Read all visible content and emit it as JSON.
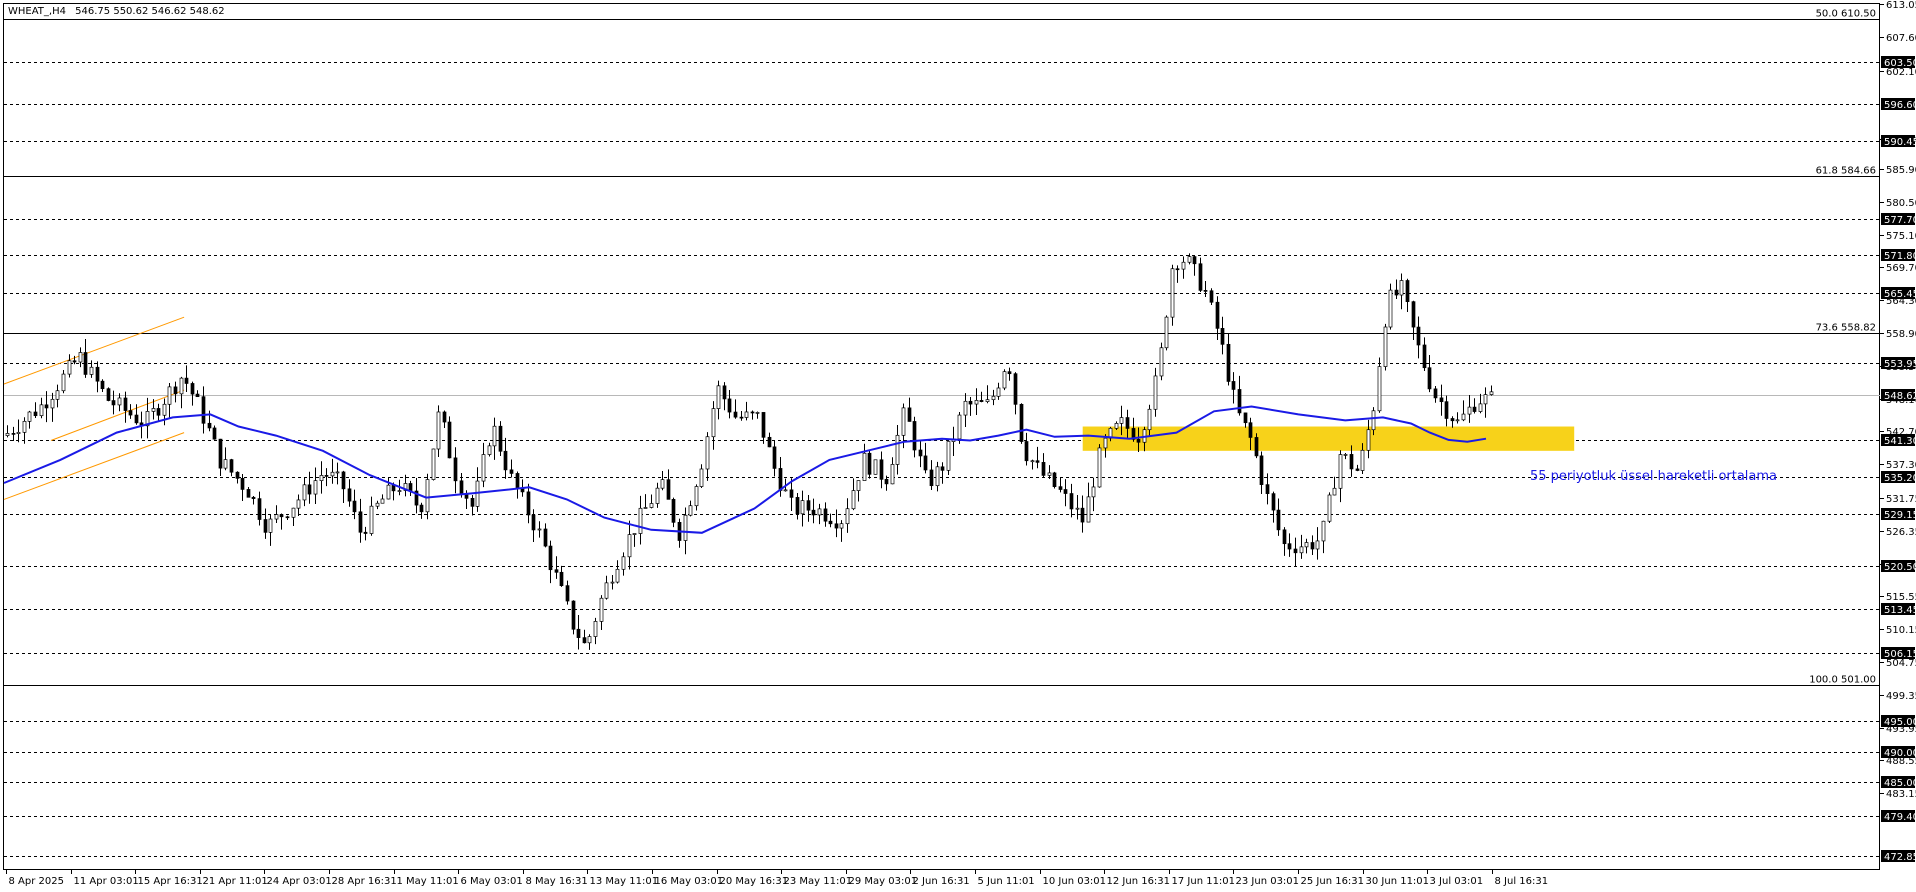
{
  "header": {
    "symbol": "WHEAT_,H4",
    "ohlc": "546.75 550.62 546.62 548.62"
  },
  "chart_data": {
    "type": "candlestick",
    "ylim": [
      470.5,
      613.05
    ],
    "y_ticks": [
      613.05,
      607.6,
      602.1,
      590.9,
      585.9,
      580.5,
      575.1,
      569.7,
      564.3,
      558.9,
      553.5,
      548.1,
      542.7,
      537.3,
      531.75,
      526.35,
      520.95,
      515.55,
      510.15,
      504.75,
      499.35,
      493.95,
      488.55,
      483.15
    ],
    "x_labels": [
      "8 Apr 2025",
      "11 Apr 03:01",
      "15 Apr 16:31",
      "21 Apr 11:01",
      "24 Apr 03:01",
      "28 Apr 16:31",
      "1 May 11:01",
      "6 May 03:01",
      "8 May 16:31",
      "13 May 11:01",
      "16 May 03:01",
      "20 May 16:31",
      "23 May 11:01",
      "29 May 03:01",
      "2 Jun 16:31",
      "5 Jun 11:01",
      "10 Jun 03:01",
      "12 Jun 16:31",
      "17 Jun 11:01",
      "23 Jun 03:01",
      "25 Jun 16:31",
      "30 Jun 11:01",
      "3 Jul 03:01",
      "8 Jul 16:31"
    ],
    "levels": [
      603.5,
      596.6,
      590.45,
      577.7,
      571.8,
      565.45,
      553.95,
      541.3,
      535.2,
      529.15,
      520.5,
      513.45,
      506.15,
      495.0,
      490.0,
      485.0,
      479.4,
      472.85
    ],
    "current_price": 548.62,
    "fib_levels": [
      {
        "label": "50.0 610.50",
        "value": 610.5
      },
      {
        "label": "61.8 584.66",
        "value": 584.66
      },
      {
        "label": "73.6 558.82",
        "value": 558.82
      },
      {
        "label": "100.0 501.00",
        "value": 501.0
      }
    ],
    "zone": {
      "low": 539.5,
      "high": 543.5,
      "x_from": 0.575,
      "x_to": 0.837
    },
    "ema_label": "55 periyotluk üssel hareketli ortalama",
    "price_path": [
      [
        0.0,
        542
      ],
      [
        0.02,
        547
      ],
      [
        0.04,
        555
      ],
      [
        0.055,
        548
      ],
      [
        0.075,
        544
      ],
      [
        0.095,
        552
      ],
      [
        0.105,
        546
      ],
      [
        0.115,
        538
      ],
      [
        0.13,
        533
      ],
      [
        0.14,
        527
      ],
      [
        0.155,
        531
      ],
      [
        0.17,
        536
      ],
      [
        0.18,
        534
      ],
      [
        0.19,
        526
      ],
      [
        0.2,
        531
      ],
      [
        0.21,
        534
      ],
      [
        0.222,
        530
      ],
      [
        0.232,
        546
      ],
      [
        0.24,
        536
      ],
      [
        0.25,
        530
      ],
      [
        0.26,
        544
      ],
      [
        0.27,
        535
      ],
      [
        0.285,
        526
      ],
      [
        0.295,
        518
      ],
      [
        0.303,
        511
      ],
      [
        0.31,
        507
      ],
      [
        0.318,
        515
      ],
      [
        0.326,
        521
      ],
      [
        0.336,
        527
      ],
      [
        0.35,
        534
      ],
      [
        0.36,
        526
      ],
      [
        0.372,
        538
      ],
      [
        0.38,
        550
      ],
      [
        0.39,
        545
      ],
      [
        0.402,
        545
      ],
      [
        0.41,
        537
      ],
      [
        0.42,
        530
      ],
      [
        0.432,
        530
      ],
      [
        0.446,
        528
      ],
      [
        0.458,
        538
      ],
      [
        0.47,
        535
      ],
      [
        0.48,
        546
      ],
      [
        0.492,
        534
      ],
      [
        0.5,
        537
      ],
      [
        0.512,
        547
      ],
      [
        0.525,
        547
      ],
      [
        0.535,
        555
      ],
      [
        0.543,
        540
      ],
      [
        0.552,
        536
      ],
      [
        0.562,
        533
      ],
      [
        0.575,
        528
      ],
      [
        0.585,
        540
      ],
      [
        0.595,
        544
      ],
      [
        0.605,
        542
      ],
      [
        0.615,
        552
      ],
      [
        0.623,
        571
      ],
      [
        0.63,
        571
      ],
      [
        0.64,
        566
      ],
      [
        0.648,
        558
      ],
      [
        0.657,
        546
      ],
      [
        0.665,
        541
      ],
      [
        0.673,
        532
      ],
      [
        0.682,
        524
      ],
      [
        0.694,
        524
      ],
      [
        0.702,
        525
      ],
      [
        0.712,
        539
      ],
      [
        0.722,
        536
      ],
      [
        0.73,
        547
      ],
      [
        0.737,
        564
      ],
      [
        0.745,
        566
      ],
      [
        0.752,
        558
      ],
      [
        0.762,
        549
      ],
      [
        0.775,
        544
      ],
      [
        0.785,
        548
      ],
      [
        0.795,
        548
      ]
    ],
    "ema_path": [
      [
        0.0,
        534.2
      ],
      [
        0.03,
        538
      ],
      [
        0.06,
        542.5
      ],
      [
        0.09,
        545
      ],
      [
        0.11,
        545.5
      ],
      [
        0.125,
        543.5
      ],
      [
        0.145,
        542
      ],
      [
        0.17,
        539.5
      ],
      [
        0.195,
        535.5
      ],
      [
        0.225,
        531.8
      ],
      [
        0.25,
        532.5
      ],
      [
        0.28,
        533.5
      ],
      [
        0.3,
        531.5
      ],
      [
        0.32,
        528.5
      ],
      [
        0.345,
        526.5
      ],
      [
        0.372,
        526
      ],
      [
        0.4,
        530
      ],
      [
        0.42,
        534.5
      ],
      [
        0.44,
        538
      ],
      [
        0.46,
        539.5
      ],
      [
        0.48,
        541
      ],
      [
        0.5,
        541.5
      ],
      [
        0.515,
        541.2
      ],
      [
        0.53,
        542
      ],
      [
        0.545,
        543
      ],
      [
        0.56,
        541.8
      ],
      [
        0.578,
        542
      ],
      [
        0.6,
        541.5
      ],
      [
        0.625,
        542.5
      ],
      [
        0.645,
        546
      ],
      [
        0.665,
        546.8
      ],
      [
        0.69,
        545.5
      ],
      [
        0.715,
        544.5
      ],
      [
        0.735,
        545
      ],
      [
        0.75,
        544
      ],
      [
        0.76,
        542.5
      ],
      [
        0.77,
        541.3
      ],
      [
        0.78,
        541
      ],
      [
        0.79,
        541.5
      ]
    ],
    "channel": {
      "upper": [
        [
          0.0,
          550.5
        ],
        [
          0.096,
          561.5
        ]
      ],
      "mid": [
        [
          0.025,
          541.2
        ],
        [
          0.096,
          549.5
        ]
      ],
      "lower": [
        [
          0.0,
          531.5
        ],
        [
          0.096,
          542.5
        ]
      ]
    }
  }
}
